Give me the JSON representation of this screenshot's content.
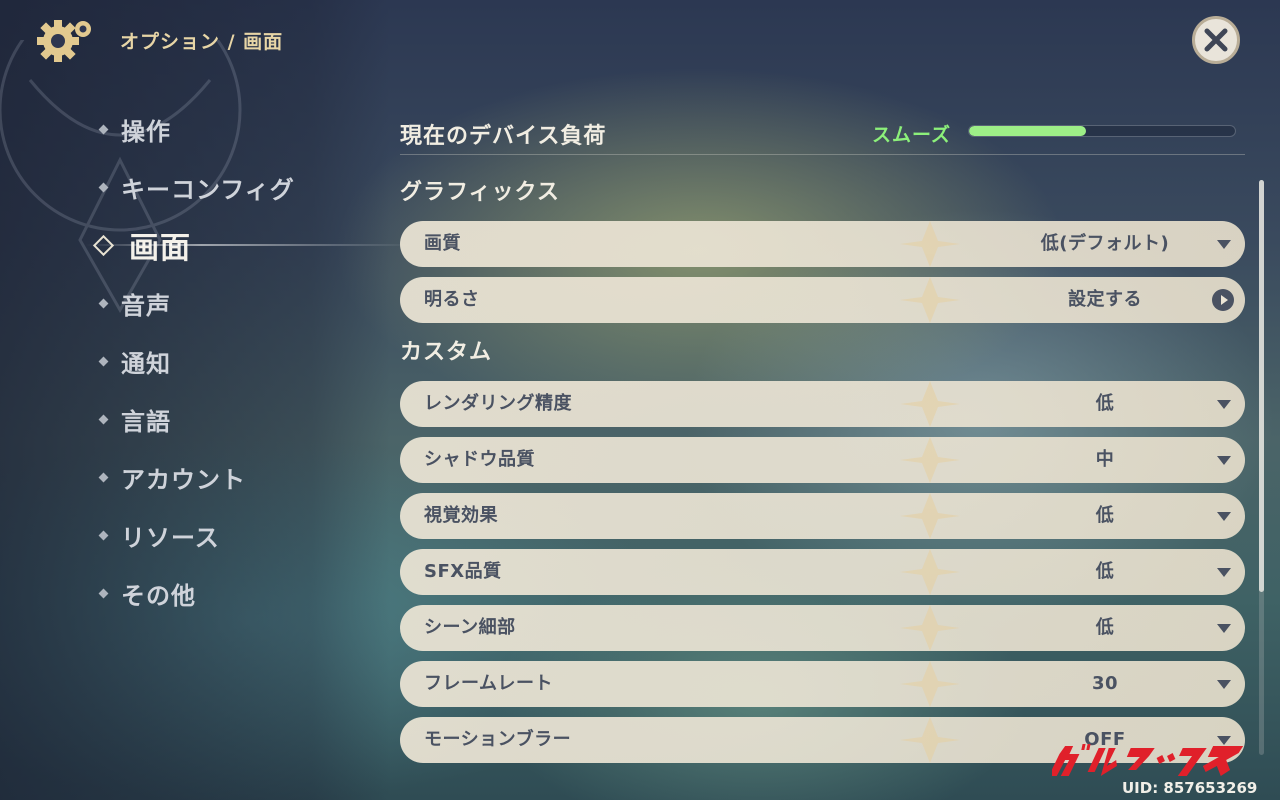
{
  "header": {
    "breadcrumb": "オプション / 画面",
    "close_icon": "close-icon",
    "settings_icon": "gear-icon"
  },
  "sidebar": {
    "items": [
      {
        "label": "操作",
        "active": false
      },
      {
        "label": "キーコンフィグ",
        "active": false
      },
      {
        "label": "画面",
        "active": true
      },
      {
        "label": "音声",
        "active": false
      },
      {
        "label": "通知",
        "active": false
      },
      {
        "label": "言語",
        "active": false
      },
      {
        "label": "アカウント",
        "active": false
      },
      {
        "label": "リソース",
        "active": false
      },
      {
        "label": "その他",
        "active": false
      }
    ]
  },
  "device_load": {
    "title": "現在のデバイス負荷",
    "status": "スムーズ",
    "level_fraction": 0.44,
    "status_color": "#8cf07a"
  },
  "graphics": {
    "title": "グラフィックス",
    "rows": [
      {
        "label": "画質",
        "value": "低(デフォルト)",
        "control": "dropdown"
      },
      {
        "label": "明るさ",
        "value": "設定する",
        "control": "link"
      }
    ]
  },
  "custom": {
    "title": "カスタム",
    "rows": [
      {
        "label": "レンダリング精度",
        "value": "低",
        "control": "dropdown"
      },
      {
        "label": "シャドウ品質",
        "value": "中",
        "control": "dropdown"
      },
      {
        "label": "視覚効果",
        "value": "低",
        "control": "dropdown"
      },
      {
        "label": "SFX品質",
        "value": "低",
        "control": "dropdown"
      },
      {
        "label": "シーン細部",
        "value": "低",
        "control": "dropdown"
      },
      {
        "label": "フレームレート",
        "value": "30",
        "control": "dropdown"
      },
      {
        "label": "モーションブラー",
        "value": "OFF",
        "control": "dropdown"
      }
    ]
  },
  "watermark": {
    "text": "ガルマックス",
    "color": "#e0202a"
  },
  "uid": "UID: 857653269"
}
